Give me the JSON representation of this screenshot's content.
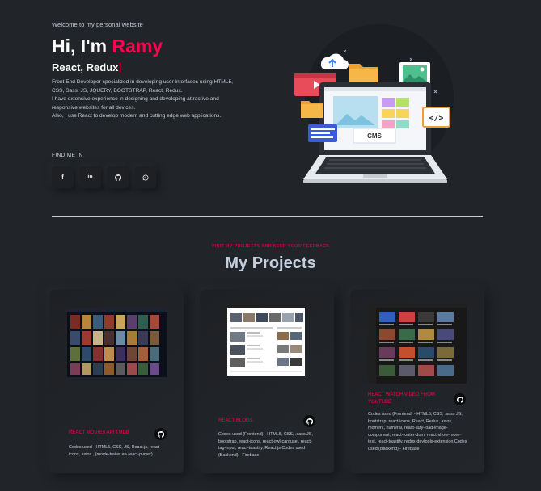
{
  "hero": {
    "welcome": "Welcome to my personal website",
    "greeting": "Hi, I'm",
    "name": "Ramy",
    "role": "React, Redux",
    "bio": [
      "Front End Developer specialized in developing user interfaces using HTML5,",
      "CSS, Sass, JS, JQUERY, BOOTSTRAP, React, Redux.",
      "I have extensive experience in designing and developing attractive and",
      "responsive websites for all devices.",
      "Also, I use React to develop modern and cutting edge web applications."
    ],
    "illustration_label": "CMS"
  },
  "social": {
    "heading": "FIND ME IN",
    "links": [
      {
        "icon": "facebook-icon",
        "glyph": "f"
      },
      {
        "icon": "linkedin-icon",
        "glyph": "in"
      },
      {
        "icon": "github-icon"
      },
      {
        "icon": "whatsapp-icon"
      }
    ]
  },
  "projects": {
    "subtitle": "VISIT MY PROJECTS AND KEEP YOUR FEEDBACK",
    "title": "My Projects",
    "items": [
      {
        "title": "REACT MOVIES API TMDB",
        "description": "Codes used - HTML5, CSS, JS, React.js, react icons, axios , (movie-trailer => react-player)"
      },
      {
        "title": "REACT BLOGS",
        "description": "Codes used (Frontend) - HTML5, CSS, .sass JS, bootstrap, react-icons, react-owl-carousel, react-tag-input, react-toastify, React.js Codes used (Backend) - Firebase"
      },
      {
        "title": "REACT WATCH VIDEO FROM YOUTUBE",
        "description": "Codes used (Frontend) - HTML5, CSS, .sass JS, bootstrap, react-icons, React, Redux, axios, moment, numeral, react-lazy-load-image-component, react-router-dom, react-show-more-text, react-toastify, redux-devtools-extension Codes used (Backend) - Firebase"
      }
    ]
  },
  "colors": {
    "background": "#212428",
    "accent": "#ff014f",
    "text": "#c4cfde",
    "heading": "#ffffff"
  }
}
